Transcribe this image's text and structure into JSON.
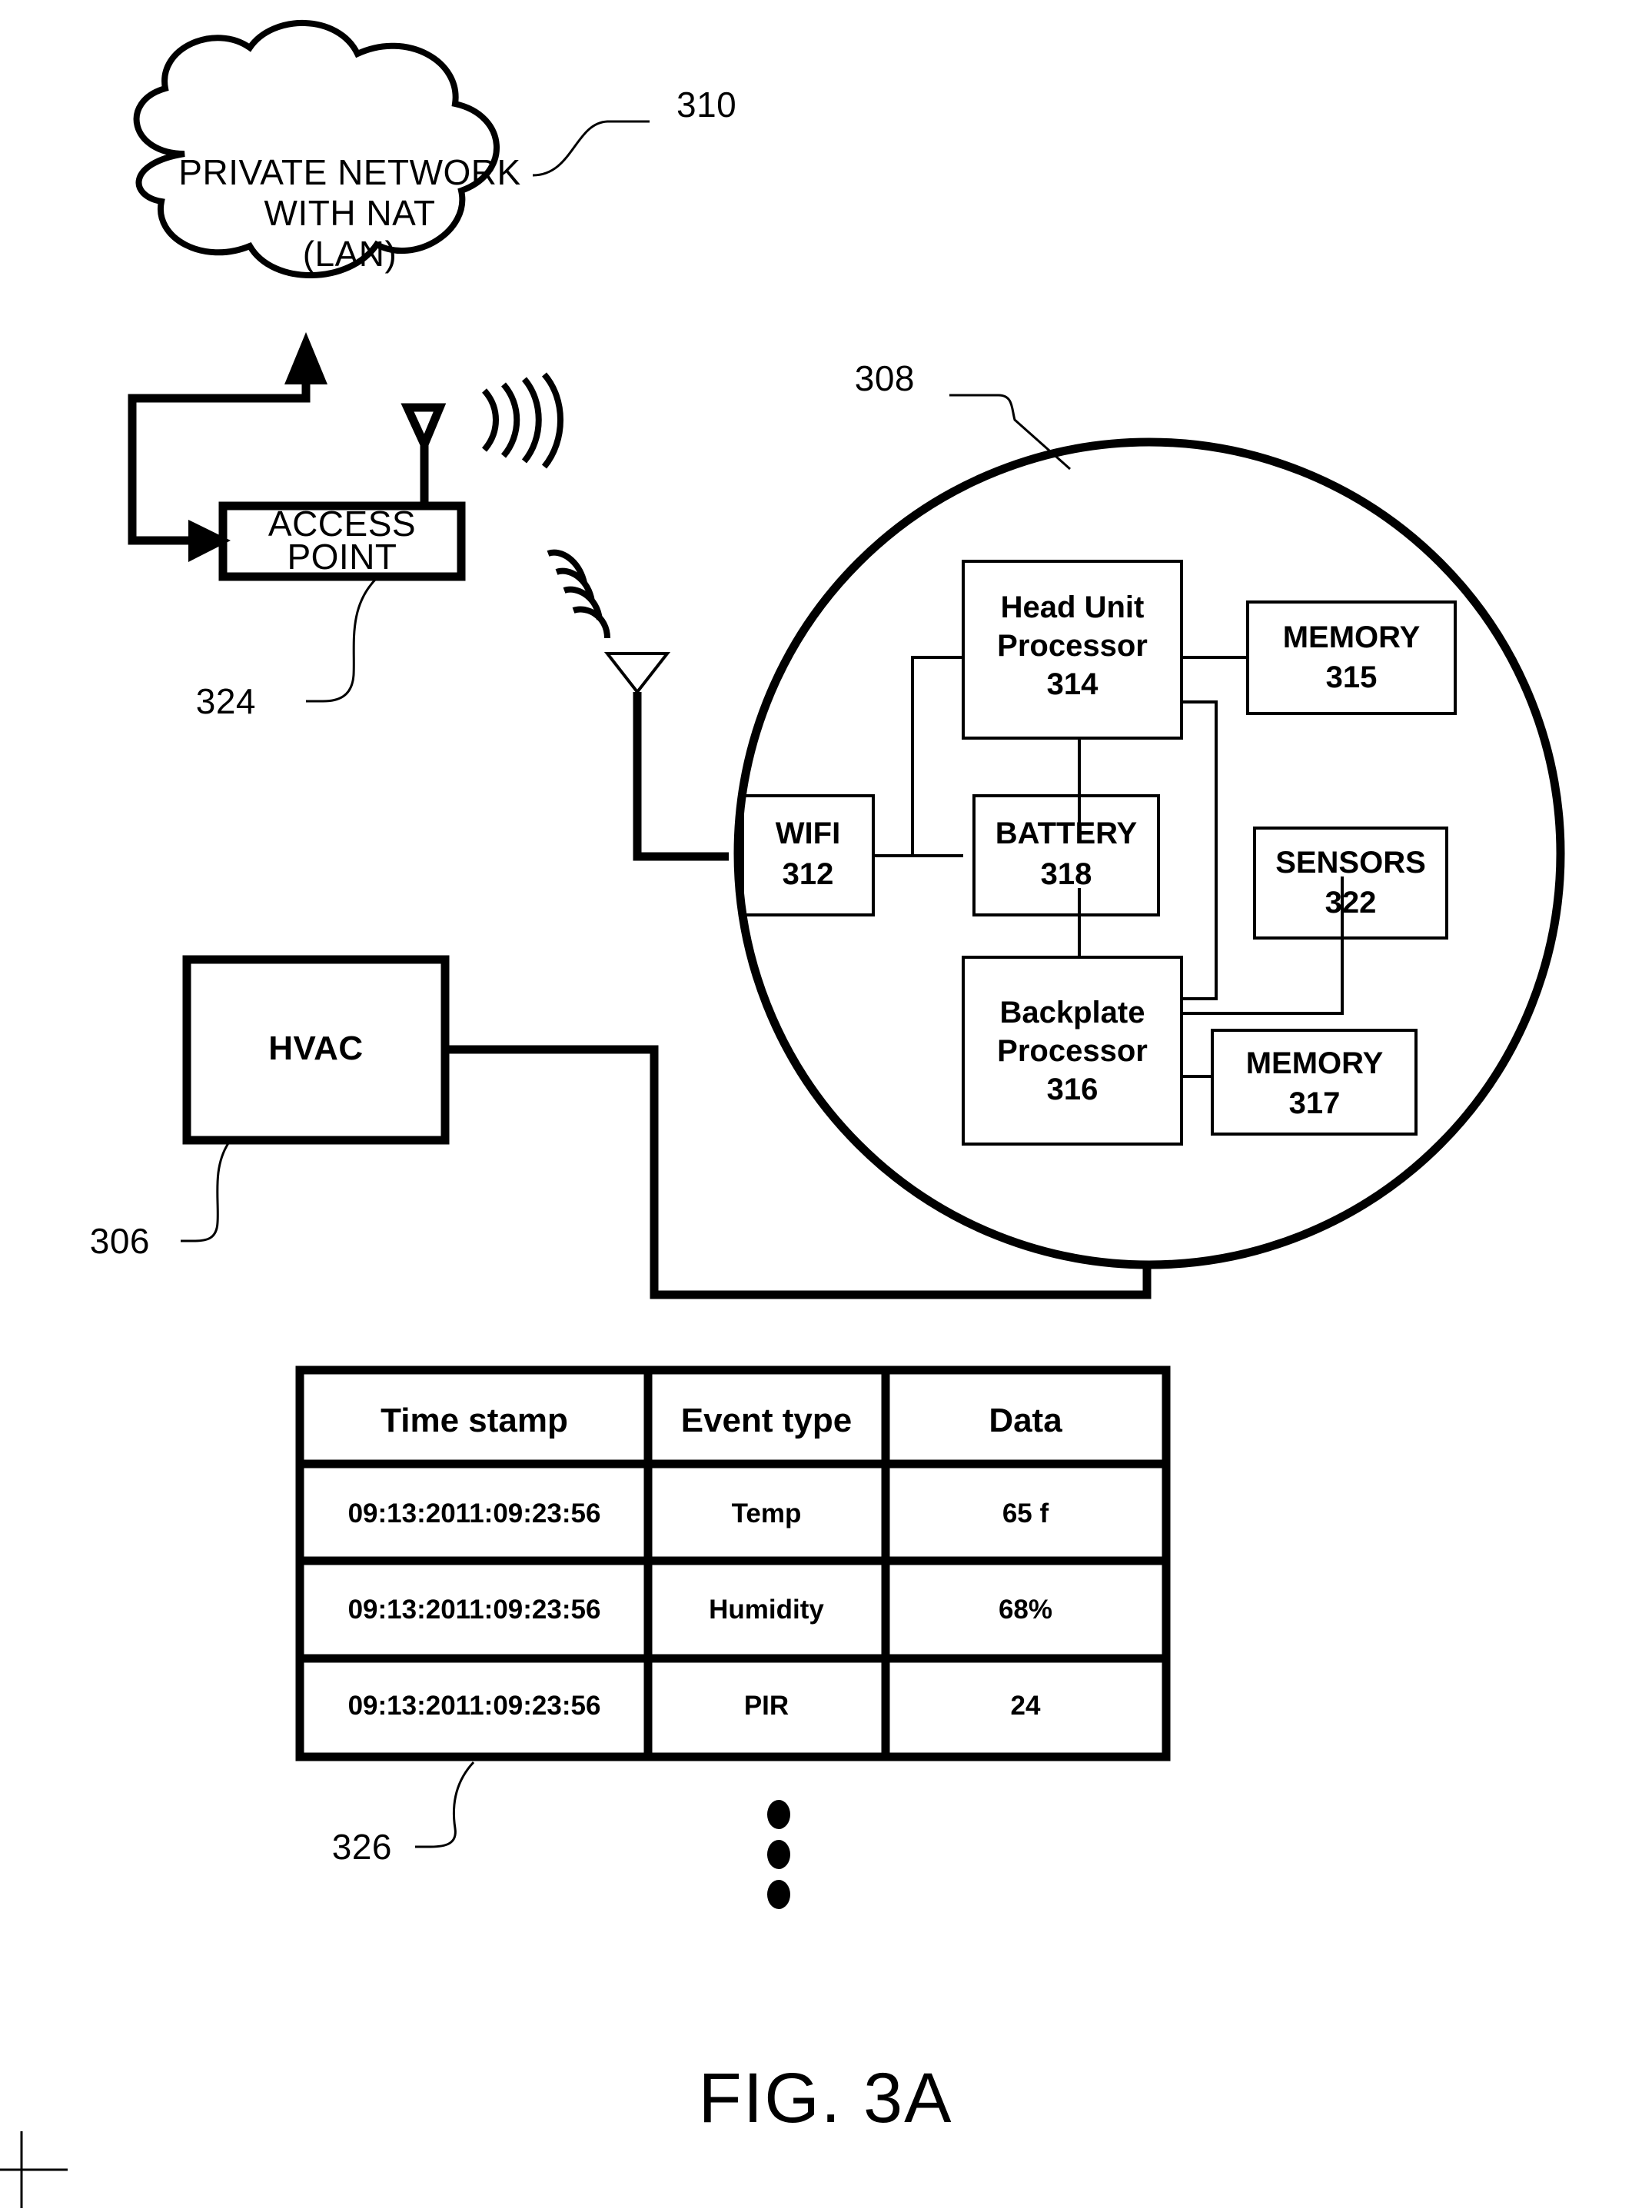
{
  "figure": {
    "caption": "FIG. 3A"
  },
  "cloud": {
    "ref": "310",
    "line1": "PRIVATE NETWORK",
    "line2": "WITH NAT",
    "line3": "(LAN)"
  },
  "access_point": {
    "ref": "324",
    "line1": "ACCESS",
    "line2": "POINT"
  },
  "hvac": {
    "ref": "306",
    "label": "HVAC"
  },
  "thermostat": {
    "ref": "308",
    "blocks": [
      {
        "name": "head-unit-processor",
        "line1": "Head Unit",
        "line2": "Processor",
        "ref": "314"
      },
      {
        "name": "memory-315",
        "line1": "MEMORY",
        "ref": "315"
      },
      {
        "name": "wifi",
        "line1": "WIFI",
        "ref": "312"
      },
      {
        "name": "battery",
        "line1": "BATTERY",
        "ref": "318"
      },
      {
        "name": "sensors",
        "line1": "SENSORS",
        "ref": "322"
      },
      {
        "name": "backplate-processor",
        "line1": "Backplate",
        "line2": "Processor",
        "ref": "316"
      },
      {
        "name": "memory-317",
        "line1": "MEMORY",
        "ref": "317"
      }
    ]
  },
  "table": {
    "ref": "326",
    "headers": [
      "Time stamp",
      "Event type",
      "Data"
    ],
    "rows": [
      [
        "09:13:2011:09:23:56",
        "Temp",
        "65 f"
      ],
      [
        "09:13:2011:09:23:56",
        "Humidity",
        "68%"
      ],
      [
        "09:13:2011:09:23:56",
        "PIR",
        "24"
      ]
    ],
    "continuation": "vertical-ellipsis"
  },
  "colors": {
    "ink": "#000000",
    "paper": "#ffffff"
  }
}
